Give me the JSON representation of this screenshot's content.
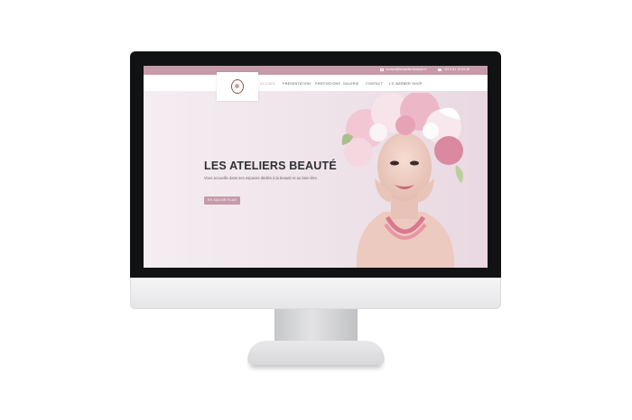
{
  "topbar": {
    "email": "contact@lesateliersbeaute.fr",
    "phone": "+33 9 81 15 84 49"
  },
  "nav": {
    "items": [
      {
        "label": "ACCUEIL",
        "active": true
      },
      {
        "label": "PRÉSENTATION"
      },
      {
        "label": "PRESTATIONS"
      },
      {
        "label": "GALERIE"
      },
      {
        "label": "CONTACT"
      },
      {
        "label": "L'E-BARBER SHOP"
      }
    ]
  },
  "hero": {
    "title": "LES ATELIERS BEAUTÉ",
    "subtitle": "Vous accueille dans ses espaces dédiés à la beauté et au bien-être.",
    "button": "EN SAVOIR PLUS"
  },
  "colors": {
    "accent": "#c79aa9",
    "bezel": "#111213",
    "hero_bg": "#efe3ea"
  },
  "icons": [
    "logo-emblem",
    "mail-icon",
    "phone-icon"
  ]
}
